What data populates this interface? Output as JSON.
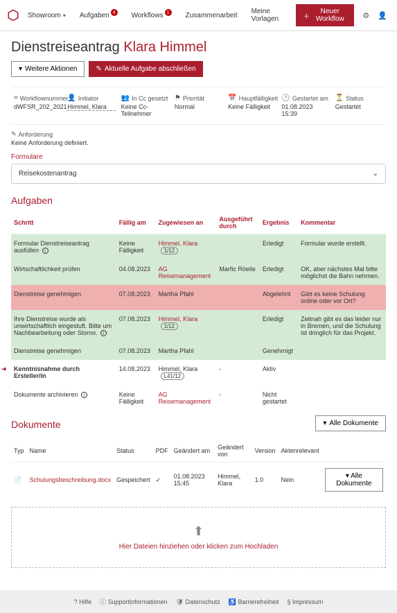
{
  "topnav": {
    "items": [
      {
        "label": "Showroom",
        "hasChevron": true
      },
      {
        "label": "Aufgaben",
        "badge": "4"
      },
      {
        "label": "Workflows",
        "badge": "1"
      },
      {
        "label": "Zusammenarbeit"
      },
      {
        "label": "Meine Vorlagen"
      }
    ],
    "newWorkflow": "Neuer Workflow"
  },
  "title": {
    "prefix": "Dienstreiseantrag",
    "name": "Klara Himmel"
  },
  "actions": {
    "more": "Weitere Aktionen",
    "complete": "Aktuelle Aufgabe abschließen"
  },
  "meta": [
    {
      "icon": "hash",
      "label": "Workflownummer",
      "value": "dWFSR_202_2021"
    },
    {
      "icon": "user",
      "label": "Initiator",
      "value": "Himmel, Klara",
      "dashed": true
    },
    {
      "icon": "users",
      "label": "In Cc gesetzt",
      "value": "Keine Cc-Teilnehmer"
    },
    {
      "icon": "flag",
      "label": "Priorität",
      "value": "Normal"
    },
    {
      "icon": "cal",
      "label": "Hauptfälligkeit",
      "value": "Keine Fälligkeit"
    },
    {
      "icon": "clock",
      "label": "Gestartet am",
      "value": "01.08.2023 15:39"
    },
    {
      "icon": "status",
      "label": "Status",
      "value": "Gestartet"
    }
  ],
  "anforderung": {
    "label": "Anforderung",
    "value": "Keine Anforderung definiert."
  },
  "formulare": {
    "link": "Formulare",
    "box": "Reisekostenantrag"
  },
  "tasks": {
    "heading": "Aufgaben",
    "columns": [
      "Schritt",
      "Fällig am",
      "Zugewiesen an",
      "Ausgeführt durch",
      "Ergebnis",
      "Kommentar"
    ],
    "rows": [
      {
        "cls": "row-green",
        "step": "Formular Dienstreiseantrag ausfüllen",
        "info": true,
        "due": "Keine Fälligkeit",
        "assigned": "Himmel, Klara",
        "assignedBadge": "1/12",
        "assignedRed": true,
        "by": "",
        "result": "Erledigt",
        "comment": "Formular wurde erstellt."
      },
      {
        "cls": "row-green",
        "step": "Wirtschaftlichkeit prüfen",
        "due": "04.08.2023",
        "assigned": "AG Reisemanagement",
        "assignedRed": true,
        "by": "Marfic Röelle",
        "result": "Erledigt",
        "comment": "OK, aber nächstes Mal bitte möglichst die Bahn nehmen."
      },
      {
        "cls": "row-red",
        "step": "Dienstreise genehmigen",
        "due": "07.08.2023",
        "assigned": "Martha Pfahl",
        "by": "",
        "result": "Abgelehnt",
        "comment": "Gibt es keine Schulung online oder vor Ort?"
      },
      {
        "cls": "row-green",
        "step": "Ihre Dienstreise wurde als unwirtschaftlich eingestuft. Bitte um Nachbearbeitung oder Storno.",
        "info": true,
        "due": "07.08.2023",
        "assigned": "Himmel, Klara",
        "assignedBadge": "1/12",
        "assignedRed": true,
        "by": "",
        "result": "Erledigt",
        "comment": "Zeitnah gibt es das leider nur in Bremen, und die Schulung ist dringlich für das Projekt."
      },
      {
        "cls": "row-green",
        "step": "Dienstreise genehmigen",
        "due": "07.08.2023",
        "assigned": "Martha Pfahl",
        "by": "",
        "result": "Genehmigt",
        "comment": ""
      },
      {
        "cls": "",
        "active": true,
        "step": "Kenntnisnahme durch Ersteller/in",
        "bold": true,
        "due": "14.08.2023",
        "assigned": "Himmel, Klara",
        "assignedBadge": "L41/12",
        "by": "-",
        "result": "Aktiv",
        "comment": ""
      },
      {
        "cls": "",
        "step": "Dokumente archivieren",
        "info": true,
        "due": "Keine Fälligkeit",
        "assigned": "AG Reisemanagement",
        "assignedRed": true,
        "by": "-",
        "result": "Nicht gestartet",
        "comment": ""
      }
    ]
  },
  "docs": {
    "heading": "Dokumente",
    "allBtn": "Alle Dokumente",
    "columns": [
      "Typ",
      "Name",
      "Status",
      "PDF",
      "Geändert am",
      "Geändert von",
      "Version",
      "Aktenrelevant",
      ""
    ],
    "rows": [
      {
        "name": "Schulungsbeschreibung.docx",
        "status": "Gespeichert",
        "pdf": "✓",
        "changedAt": "01.08.2023 15:45",
        "changedBy": "Himmel, Klara",
        "version": "1.0",
        "relevant": "Nein"
      }
    ],
    "dropzone": "Hier Dateien hinziehen oder klicken zum Hochladen"
  },
  "footer": {
    "items": [
      "Hilfe",
      "Supportinformationen",
      "Datenschutz",
      "Barrierefreiheit",
      "Impressum"
    ]
  }
}
